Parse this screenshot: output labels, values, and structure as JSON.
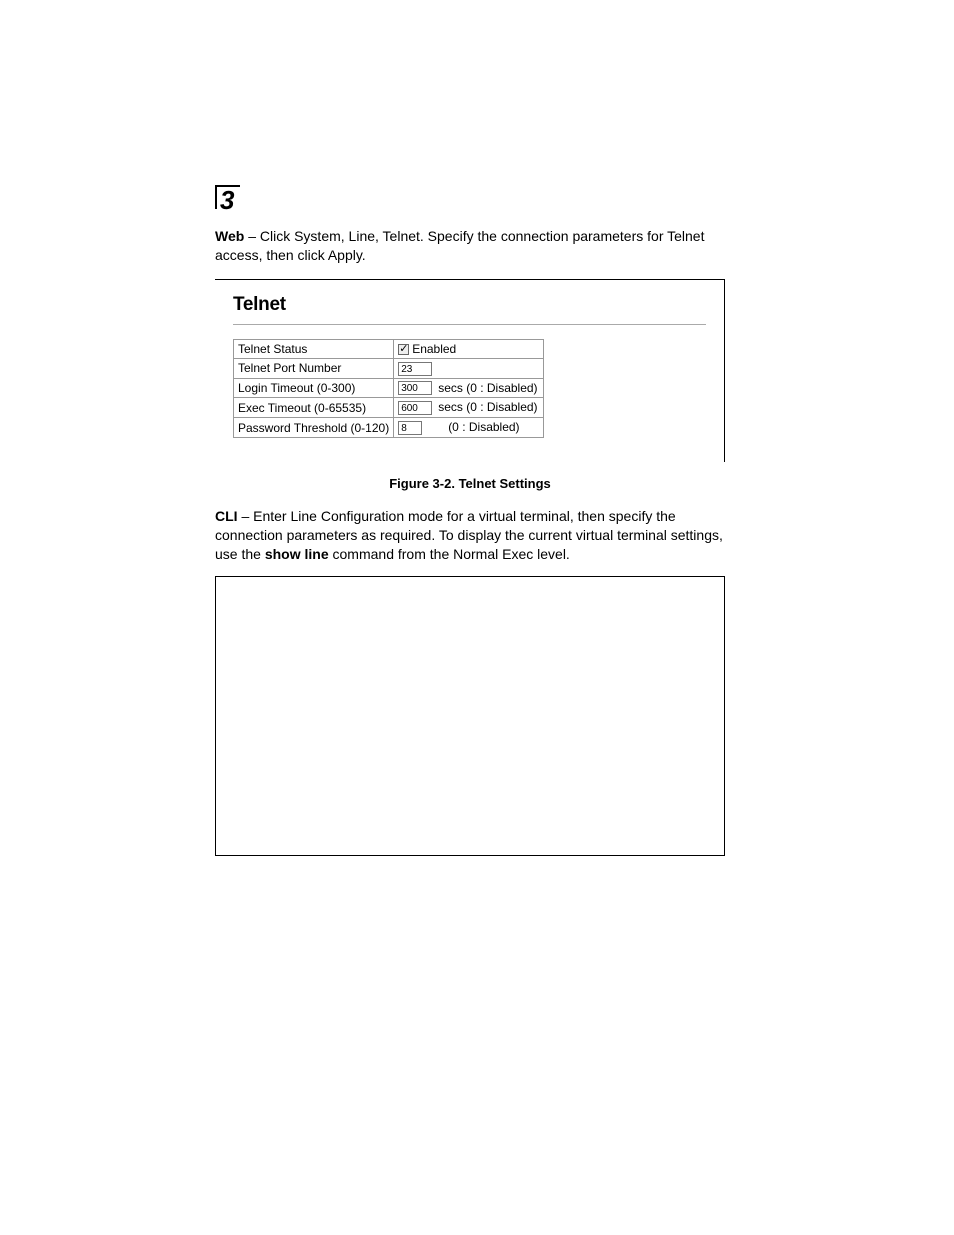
{
  "chapter": "3",
  "intro_web": {
    "lead": "Web",
    "text": " – Click System, Line, Telnet. Specify the connection parameters for Telnet access, then click Apply."
  },
  "panel": {
    "title": "Telnet",
    "rows": {
      "status": {
        "label": "Telnet Status",
        "enabled_label": "Enabled"
      },
      "port": {
        "label": "Telnet Port Number",
        "value": "23"
      },
      "login": {
        "label": "Login Timeout (0-300)",
        "value": "300",
        "unit": "secs (0 : Disabled)"
      },
      "exec": {
        "label": "Exec Timeout (0-65535)",
        "value": "600",
        "unit": "secs (0 : Disabled)"
      },
      "pwd": {
        "label": "Password Threshold (0-120)",
        "value": "8",
        "unit": "(0 : Disabled)"
      }
    }
  },
  "figure_caption": "Figure 3-2.   Telnet Settings",
  "intro_cli": {
    "lead": "CLI",
    "text1": " – Enter Line Configuration mode for a virtual terminal, then specify the connection parameters as required. To display the current virtual terminal settings, use the ",
    "cmd": "show line",
    "text2": " command from the Normal Exec level."
  }
}
